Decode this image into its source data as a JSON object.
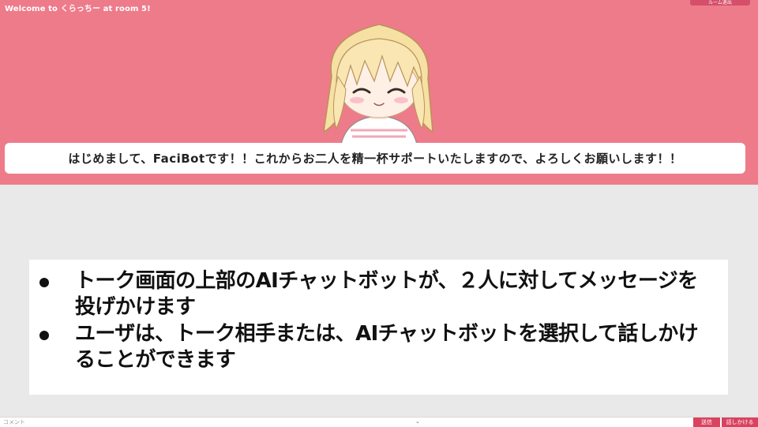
{
  "header": {
    "room_title": "Welcome to くらっちー at room 5!",
    "menu_button": "ルーム退出",
    "background_color": "#ee7b8a"
  },
  "avatar": {
    "icon": "smiling-anime-girl-avatar-icon"
  },
  "bot_message": "はじめまして、FaciBotです！！これからお二人を精一杯サポートいたしますので、よろしくお願いします！！",
  "notes": [
    "トーク画面の上部のAIチャットボットが、２人に対してメッセージを投げかけます",
    "ユーザは、トーク相手または、AIチャットボットを選択して話しかけることができます"
  ],
  "composer": {
    "placeholder": "コメント",
    "dropdown_icon": "⌄",
    "send_label": "送信",
    "talk_label": "話しかける",
    "accent_color": "#d9435f"
  }
}
